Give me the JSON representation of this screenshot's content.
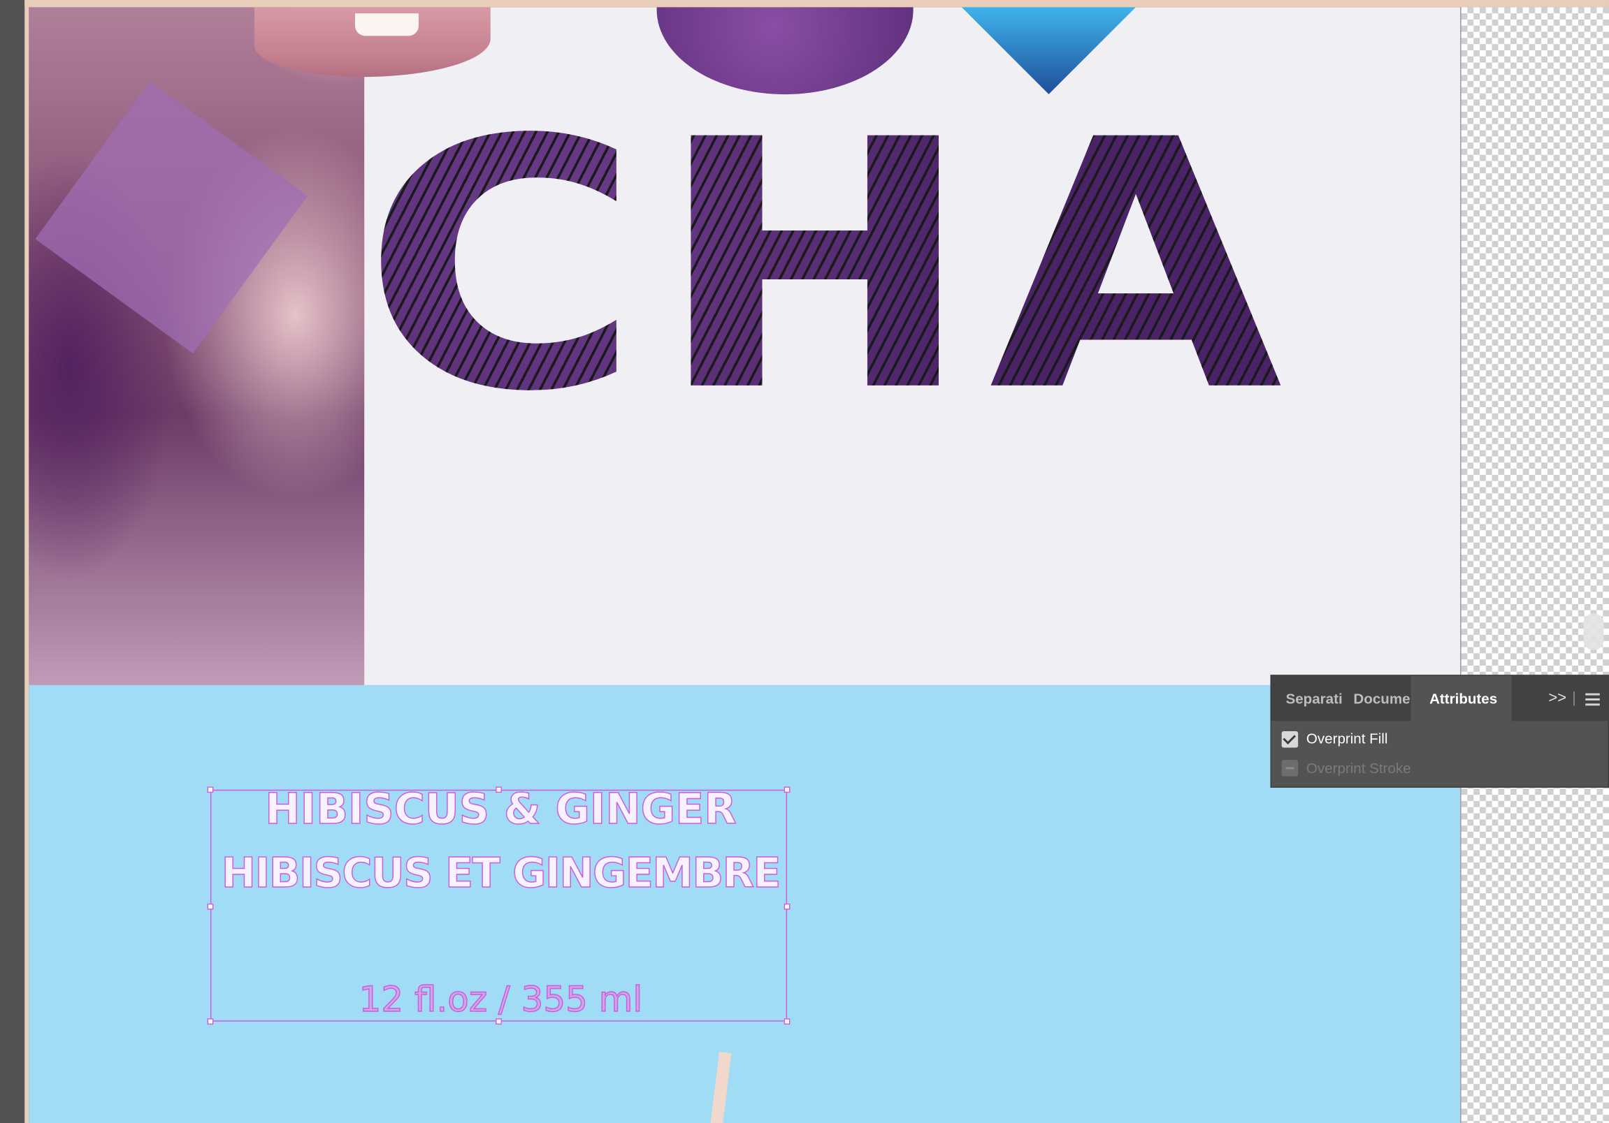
{
  "artwork": {
    "headline_letters": "CHA",
    "label_line1": "HIBISCUS & GINGER",
    "label_line2": "HIBISCUS ET GINGEMBRE",
    "volume": "12 fl.oz / 355 ml",
    "colors": {
      "top_background": "#f0eff4",
      "bottom_background": "#a0dcf6",
      "frame_selection": "#d25ad8",
      "bleed_guide": "#e9cdbb"
    }
  },
  "attributes_panel": {
    "tabs": [
      {
        "label": "Separati",
        "active": false
      },
      {
        "label": "Docume",
        "active": false
      },
      {
        "label": "Attributes",
        "active": true
      }
    ],
    "expand_glyph": ">>",
    "options": [
      {
        "label": "Overprint Fill",
        "checked": true,
        "enabled": true
      },
      {
        "label": "Overprint Stroke",
        "checked": false,
        "enabled": false
      }
    ]
  }
}
